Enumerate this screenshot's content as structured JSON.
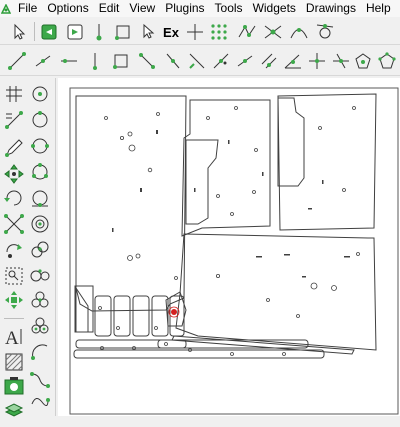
{
  "menu": {
    "items": [
      "File",
      "Options",
      "Edit",
      "View",
      "Plugins",
      "Tools",
      "Widgets",
      "Drawings",
      "Help"
    ]
  },
  "toolbar1": {
    "ex_label": "Ex",
    "icons": [
      "select-arrow-icon",
      "layer-green-icon",
      "layer-white-icon",
      "snap-node-icon",
      "snap-rectangle-icon",
      "cursor-icon",
      "explode-icon",
      "crosshair-icon",
      "dot-grid-icon",
      "polyline-snap-icon",
      "intersection-snap-icon",
      "curve-snap-icon",
      "tangent-snap-icon"
    ]
  },
  "toolbar2": {
    "icons": [
      "line-icon",
      "segment-icon",
      "polyline-icon",
      "vertical-line-icon",
      "rectangle-icon",
      "arc-segment-icon",
      "slash-line-icon",
      "diagonal-line-icon",
      "hatch-line-icon",
      "midpoint-line-icon",
      "parallel-line-icon",
      "bisect-icon",
      "angle-line-icon",
      "tangent-circle-icon",
      "tangent-line-icon",
      "perpendicular-icon",
      "intersect-lines-icon",
      "point-pentagon-icon",
      "pentagon-icon"
    ]
  },
  "lefttoolbar": {
    "icons": [
      "grid-icon",
      "circle-icon",
      "measure-icon",
      "circle-dot-icon",
      "pencil-icon",
      "arc-circle-icon",
      "move-icon",
      "circle-3p-icon",
      "rotate-icon",
      "circle-tangent-icon",
      "scale-icon",
      "concentric-circles-icon",
      "mirror-icon",
      "circles-icon",
      "zoom-icon",
      "circles-pair-icon",
      "magnifier-icon",
      "circles-triple-icon",
      "node-move-icon",
      "circles-cluster-icon",
      "text-icon",
      "arc-icon",
      "hatch-icon",
      "arc-3p-icon",
      "image-icon",
      "spline-icon",
      "layers-icon",
      "ellipse-icon"
    ],
    "text_tool_label": "A"
  },
  "colors": {
    "accent_green": "#2e9e3a",
    "canvas_bg": "#ffffff",
    "drawing_stroke": "#404040",
    "marker_red": "#d42020"
  }
}
